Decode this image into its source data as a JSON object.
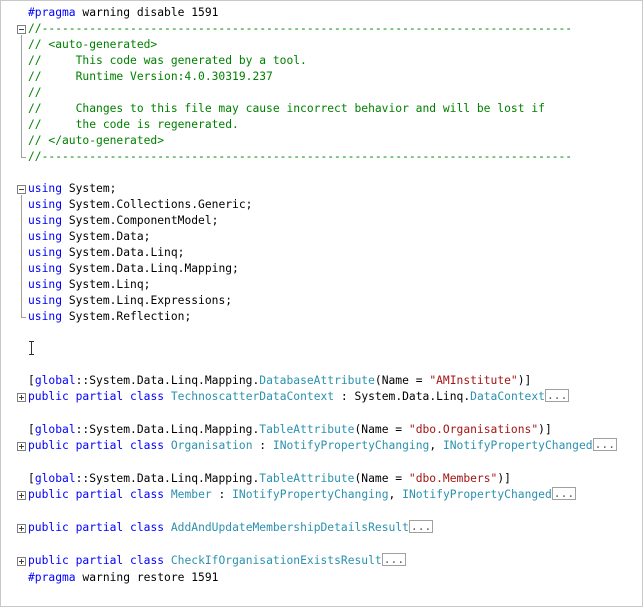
{
  "pragma_disable": {
    "directive": "#pragma",
    "text": " warning disable 1591"
  },
  "header_comment": [
    "//------------------------------------------------------------------------------",
    "// <auto-generated>",
    "//     This code was generated by a tool.",
    "//     Runtime Version:4.0.30319.237",
    "//",
    "//     Changes to this file may cause incorrect behavior and will be lost if",
    "//     the code is regenerated.",
    "// </auto-generated>",
    "//------------------------------------------------------------------------------"
  ],
  "usings": [
    "System;",
    "System.Collections.Generic;",
    "System.ComponentModel;",
    "System.Data;",
    "System.Data.Linq;",
    "System.Data.Linq.Mapping;",
    "System.Linq;",
    "System.Linq.Expressions;",
    "System.Reflection;"
  ],
  "keywords": {
    "using": "using",
    "public": "public",
    "partial": "partial",
    "class": "class",
    "global": "global"
  },
  "attr_prefix": "::System.Data.Linq.Mapping.",
  "collapsed_marker": "...",
  "classes": [
    {
      "attribute": {
        "type": "DatabaseAttribute",
        "arg": "(Name = ",
        "value": "\"AMInstitute\"",
        "close": ")]"
      },
      "name": "TechnoscatterDataContext",
      "base_prefix": " : System.Data.Linq.",
      "base_type": "DataContext"
    },
    {
      "attribute": {
        "type": "TableAttribute",
        "arg": "(Name = ",
        "value": "\"dbo.Organisations\"",
        "close": ")]"
      },
      "name": "Organisation",
      "iface1": "INotifyPropertyChanging",
      "iface2": "INotifyPropertyChanged"
    },
    {
      "attribute": {
        "type": "TableAttribute",
        "arg": "(Name = ",
        "value": "\"dbo.Members\"",
        "close": ")]"
      },
      "name": "Member",
      "iface1": "INotifyPropertyChanging",
      "iface2": "INotifyPropertyChanged"
    },
    {
      "name": "AddAndUpdateMembershipDetailsResult"
    },
    {
      "name": "CheckIfOrganisationExistsResult"
    }
  ],
  "pragma_restore": {
    "directive": "#pragma",
    "text": " warning restore 1591"
  },
  "colors": {
    "keyword": "#0000ff",
    "comment": "#008000",
    "type": "#2b91af",
    "string": "#a31515"
  }
}
